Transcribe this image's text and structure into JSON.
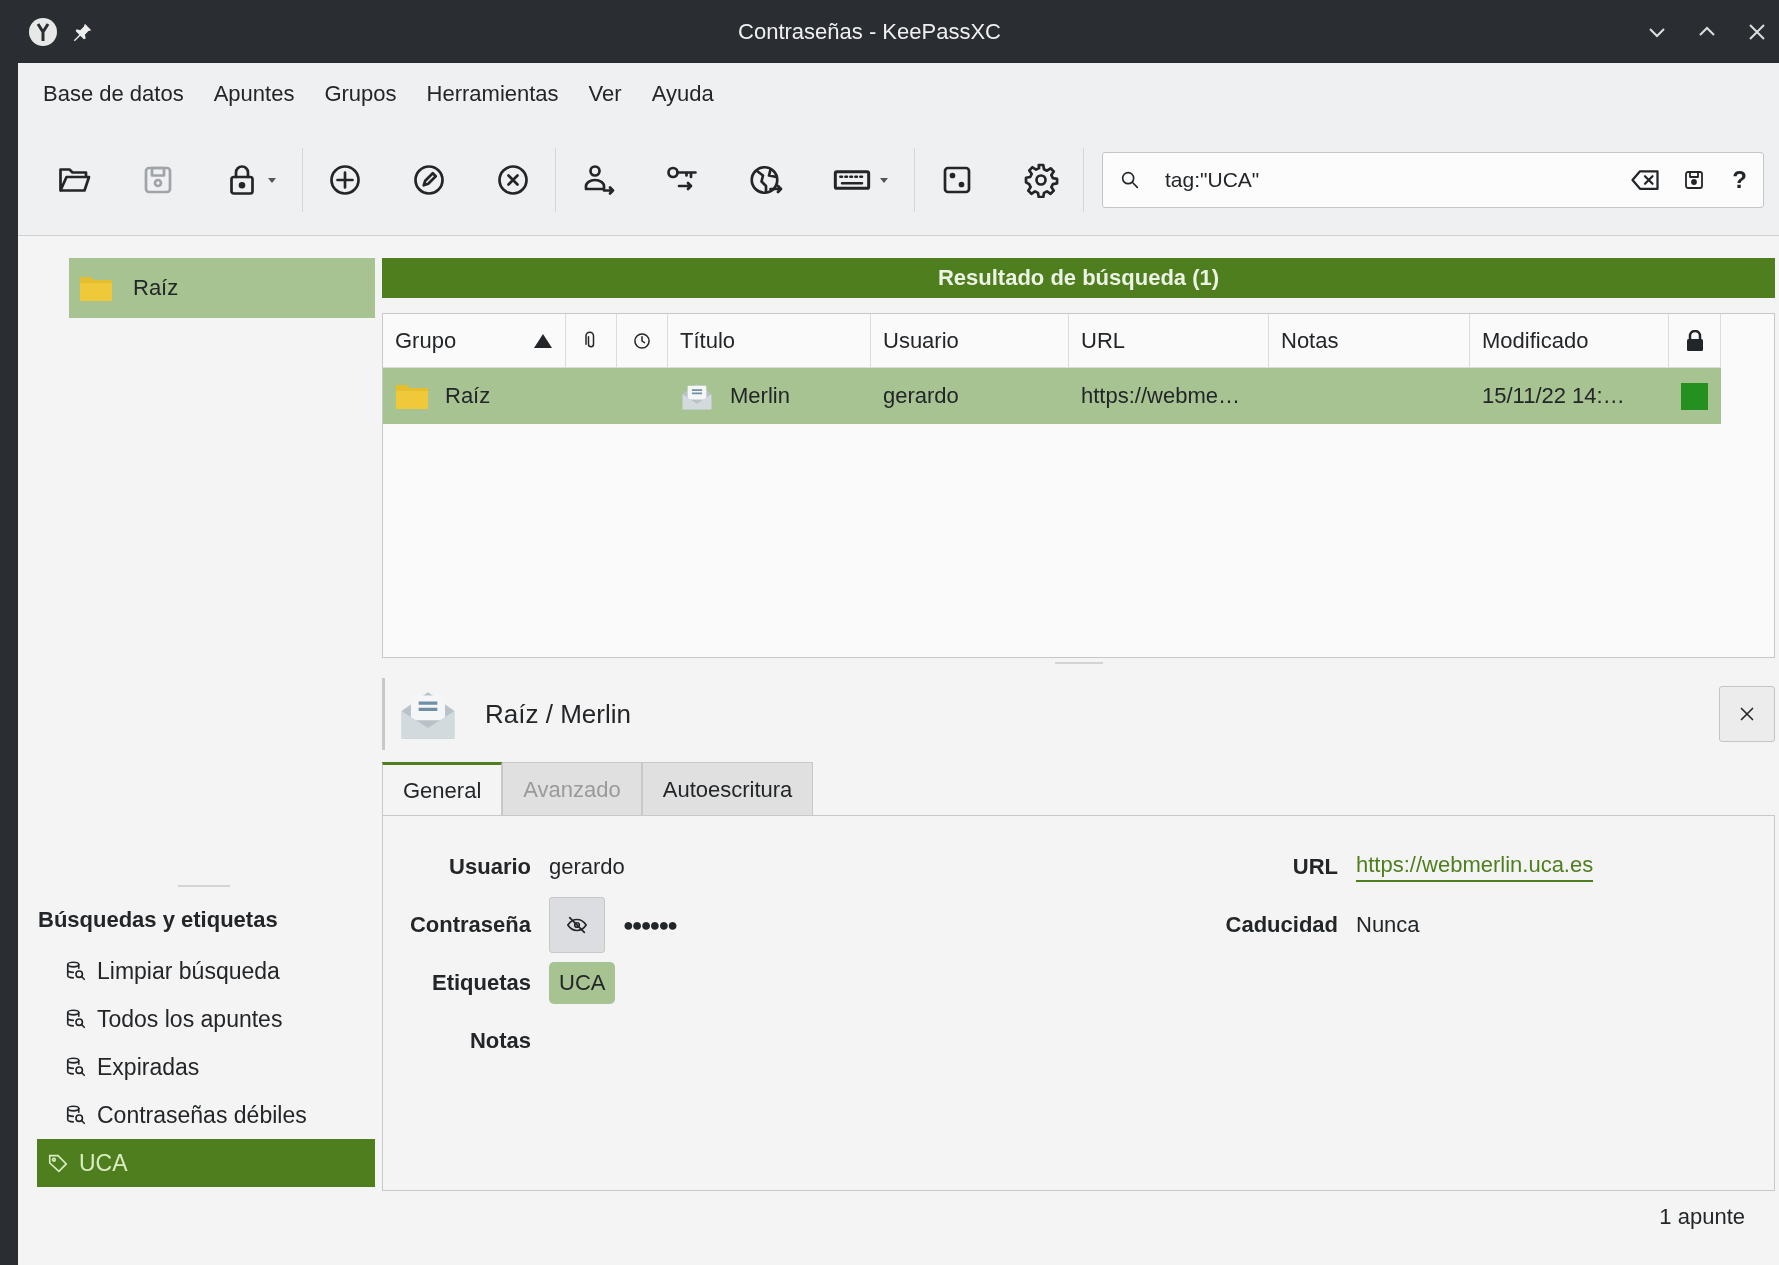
{
  "window": {
    "title": "Contraseñas - KeePassXC"
  },
  "menu": [
    "Base de datos",
    "Apuntes",
    "Grupos",
    "Herramientas",
    "Ver",
    "Ayuda"
  ],
  "search": {
    "value": "tag:\"UCA\"",
    "help_button": "?"
  },
  "groups": [
    {
      "label": "Raíz",
      "selected": true
    }
  ],
  "results_header": "Resultado de búsqueda (1)",
  "table": {
    "columns": [
      {
        "kind": "text",
        "label": "Grupo",
        "sorted": true
      },
      {
        "kind": "paperclip"
      },
      {
        "kind": "clock"
      },
      {
        "kind": "text",
        "label": "Título",
        "sorted": false
      },
      {
        "kind": "text",
        "label": "Usuario",
        "sorted": false
      },
      {
        "kind": "text",
        "label": "URL",
        "sorted": false
      },
      {
        "kind": "text",
        "label": "Notas",
        "sorted": false
      },
      {
        "kind": "text",
        "label": "Modificado",
        "sorted": false
      },
      {
        "kind": "lock"
      }
    ],
    "rows": [
      {
        "selected": true,
        "group": "Raíz",
        "title": "Merlin",
        "username": "gerardo",
        "url": "https://webme…",
        "modified": "15/11/22 14:…",
        "color": "#23901f"
      }
    ]
  },
  "detail": {
    "title": "Raíz / Merlin",
    "tabs": [
      {
        "label": "General",
        "selected": true,
        "disabled": false
      },
      {
        "label": "Avanzado",
        "selected": false,
        "disabled": true
      },
      {
        "label": "Autoescritura",
        "selected": false,
        "disabled": false
      }
    ],
    "left_fields": [
      {
        "kind": "text",
        "label": "Usuario",
        "value": "gerardo"
      },
      {
        "kind": "password",
        "label": "Contraseña",
        "value": "●●●●●●"
      },
      {
        "kind": "tags",
        "label": "Etiquetas",
        "tags": [
          "UCA"
        ]
      },
      {
        "kind": "text",
        "label": "Notas"
      }
    ],
    "right_fields": [
      {
        "kind": "link",
        "label": "URL",
        "value": "https://webmerlin.uca.es"
      },
      {
        "kind": "text",
        "label": "Caducidad",
        "value": "Nunca"
      }
    ]
  },
  "searches": {
    "heading": "Búsquedas y etiquetas",
    "items": [
      {
        "kind": "search",
        "label": "Limpiar búsqueda",
        "selected": false
      },
      {
        "kind": "search",
        "label": "Todos los apuntes",
        "selected": false
      },
      {
        "kind": "search",
        "label": "Expiradas",
        "selected": false
      },
      {
        "kind": "search",
        "label": "Contraseñas débiles",
        "selected": false
      },
      {
        "kind": "tag",
        "label": "UCA",
        "selected": true
      }
    ]
  },
  "status_bar": "1 apunte"
}
